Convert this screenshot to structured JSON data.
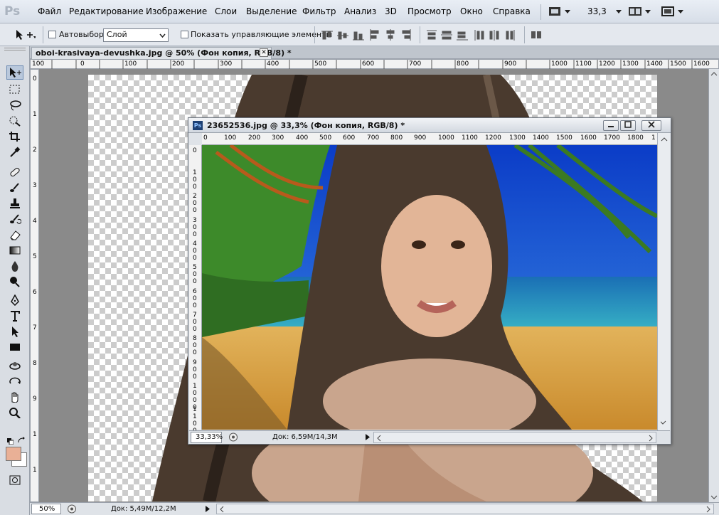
{
  "app": {
    "logo": "Ps"
  },
  "menu": {
    "items": [
      "Файл",
      "Редактирование",
      "Изображение",
      "Слои",
      "Выделение",
      "Фильтр",
      "Анализ",
      "3D",
      "Просмотр",
      "Окно",
      "Справка"
    ],
    "zoom": "33,3"
  },
  "options": {
    "autoselect_label": "Автовыбор:",
    "autoselect_value": "Слой",
    "show_controls_label": "Показать управляющие элементы"
  },
  "doc1": {
    "tab_title": "oboi-krasivaya-devushka.jpg @ 50% (Фон копия, RGB/8) *",
    "close": "✕",
    "ruler_x": [
      "100",
      "0",
      "100",
      "200",
      "300",
      "400",
      "500",
      "600",
      "700",
      "800",
      "900",
      "1000",
      "1100",
      "1200",
      "1300",
      "1400",
      "1500",
      "1600"
    ],
    "ruler_y": [
      "0",
      "1",
      "2",
      "3",
      "4",
      "5",
      "6",
      "7",
      "8",
      "9",
      "1",
      "1"
    ],
    "zoom": "50%",
    "doc_size": "Док: 5,49M/12,2M"
  },
  "doc2": {
    "title": "23652536.jpg @ 33,3% (Фон копия, RGB/8) *",
    "ruler_x": [
      "0",
      "100",
      "200",
      "300",
      "400",
      "500",
      "600",
      "700",
      "800",
      "900",
      "1000",
      "1100",
      "1200",
      "1300",
      "1400",
      "1500",
      "1600",
      "1700",
      "1800",
      "1"
    ],
    "ruler_y": [
      "0",
      "100",
      "200",
      "300",
      "400",
      "500",
      "600",
      "700",
      "800",
      "900",
      "1000",
      "1100"
    ],
    "zoom": "33,33%",
    "doc_size": "Док: 6,59M/14,3M"
  },
  "colors": {
    "foreground": "#e9b096",
    "background": "#ffffff"
  }
}
